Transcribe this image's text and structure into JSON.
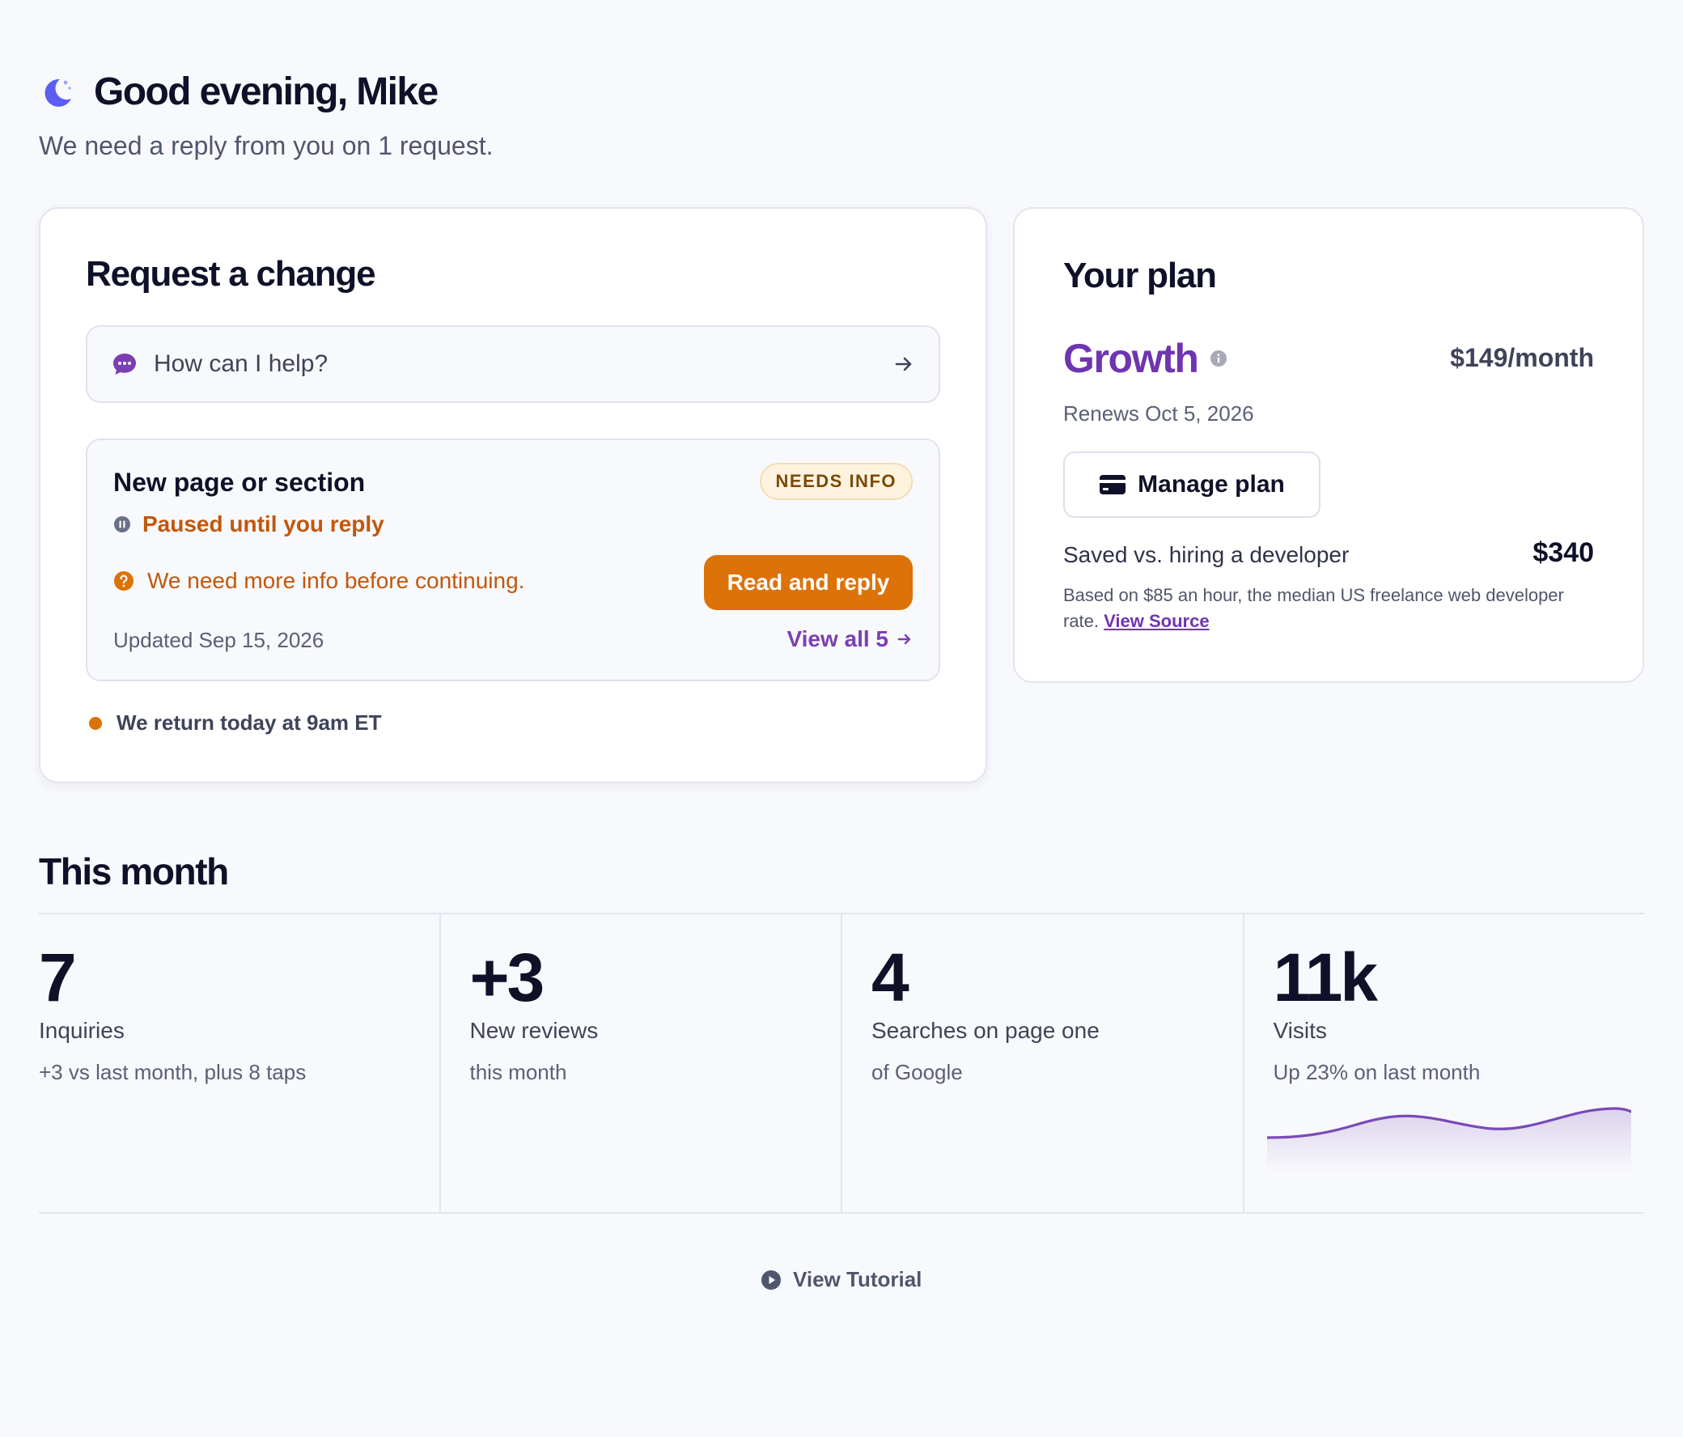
{
  "header": {
    "greeting": "Good evening, Mike",
    "subtitle": "We need a reply from you on 1 request."
  },
  "request_card": {
    "title": "Request a change",
    "input_placeholder": "How can I help?",
    "request": {
      "title": "New page or section",
      "badge": "NEEDS INFO",
      "status": "Paused until you reply",
      "message": "We need more info before continuing.",
      "reply_button": "Read and reply",
      "updated": "Updated Sep 15, 2026",
      "view_all": "View all 5"
    },
    "return_note": "We return today at 9am ET"
  },
  "plan_card": {
    "title": "Your plan",
    "plan_name": "Growth",
    "price": "$149/month",
    "renews": "Renews Oct 5, 2026",
    "manage_button": "Manage plan",
    "saved_label": "Saved vs. hiring a developer",
    "saved_value": "$340",
    "saved_note": "Based on $85 an hour, the median US freelance web developer rate.",
    "saved_link": "View Source"
  },
  "this_month": {
    "title": "This month",
    "stats": [
      {
        "value": "7",
        "label": "Inquiries",
        "sub": "+3 vs last month, plus 8 taps"
      },
      {
        "value": "+3",
        "label": "New reviews",
        "sub": "this month"
      },
      {
        "value": "4",
        "label": "Searches on page one",
        "sub": "of Google"
      },
      {
        "value": "11k",
        "label": "Visits",
        "sub": "Up 23% on last month"
      }
    ]
  },
  "footer": {
    "tutorial": "View Tutorial"
  },
  "colors": {
    "accent_purple": "#6f35b0",
    "accent_orange": "#dd7208",
    "moon": "#5b5ef0",
    "sparkline": "#7a4ab8"
  },
  "icons": [
    "moon-icon",
    "chat-bubble-icon",
    "arrow-right-icon",
    "pause-icon",
    "question-icon",
    "info-icon",
    "credit-card-icon",
    "play-icon"
  ]
}
